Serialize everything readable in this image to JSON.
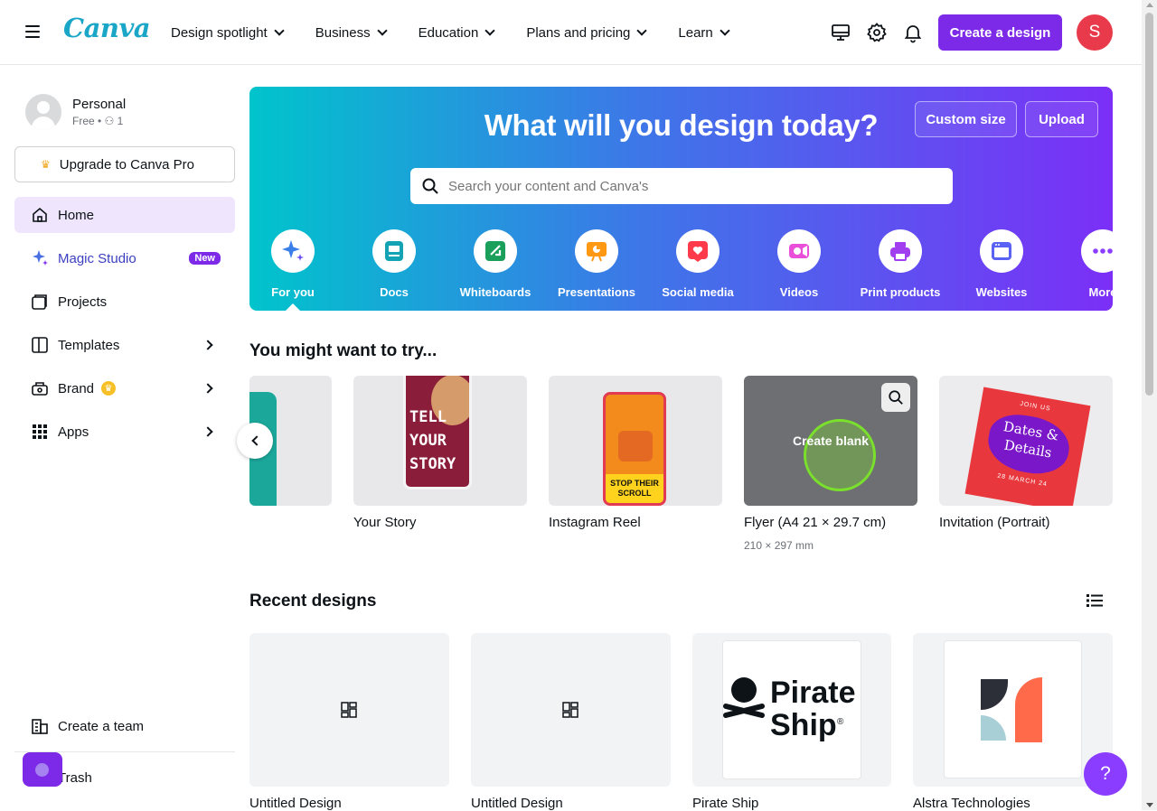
{
  "header": {
    "logo": "Canva",
    "nav": [
      {
        "label": "Design spotlight"
      },
      {
        "label": "Business"
      },
      {
        "label": "Education"
      },
      {
        "label": "Plans and pricing"
      },
      {
        "label": "Learn"
      }
    ],
    "create_label": "Create a design",
    "avatar_letter": "S"
  },
  "sidebar": {
    "profile_name": "Personal",
    "profile_sub": "Free • ⚇ 1",
    "upgrade_label": "Upgrade to Canva Pro",
    "items": [
      {
        "label": "Home"
      },
      {
        "label": "Magic Studio",
        "badge": "New"
      },
      {
        "label": "Projects"
      },
      {
        "label": "Templates"
      },
      {
        "label": "Brand"
      },
      {
        "label": "Apps"
      }
    ],
    "create_team": "Create a team",
    "trash": "Trash"
  },
  "hero": {
    "title": "What will you design today?",
    "custom_size": "Custom size",
    "upload": "Upload",
    "search_placeholder": "Search your content and Canva's",
    "categories": [
      {
        "label": "For you",
        "icon": "sparkle-icon",
        "color": "#3a7ee8"
      },
      {
        "label": "Docs",
        "icon": "doc-icon",
        "color": "#13a3b5"
      },
      {
        "label": "Whiteboards",
        "icon": "whiteboard-icon",
        "color": "#1aa05b"
      },
      {
        "label": "Presentations",
        "icon": "presentation-icon",
        "color": "#ff9914"
      },
      {
        "label": "Social media",
        "icon": "heart-icon",
        "color": "#ff3b4b"
      },
      {
        "label": "Videos",
        "icon": "video-icon",
        "color": "#e94fd8"
      },
      {
        "label": "Print products",
        "icon": "printer-icon",
        "color": "#a13ef0"
      },
      {
        "label": "Websites",
        "icon": "website-icon",
        "color": "#5a62f5"
      },
      {
        "label": "More",
        "icon": "more-icon",
        "color": "#8b3dff"
      }
    ]
  },
  "try": {
    "title": "You might want to try...",
    "cards": [
      {
        "label": "Your Story",
        "sub": "",
        "poster_text": "TELL YOUR STORY"
      },
      {
        "label": "Instagram Reel",
        "sub": "",
        "poster_text": "STOP THEIR SCROLL"
      },
      {
        "label": "Flyer (A4 21 × 29.7 cm)",
        "sub": "210 × 297 mm",
        "overlay": "Create blank"
      },
      {
        "label": "Invitation (Portrait)",
        "sub": "",
        "poster_top": "JOIN US",
        "poster_title": "Dates & Details",
        "poster_bottom": "28 MARCH 24"
      }
    ]
  },
  "recent": {
    "title": "Recent designs",
    "cards": [
      {
        "label": "Untitled Design"
      },
      {
        "label": "Untitled Design"
      },
      {
        "label": "Pirate Ship",
        "logo_text_1": "Pirate",
        "logo_text_2": "Ship",
        "mark": "®"
      },
      {
        "label": "Alstra Technologies"
      }
    ]
  },
  "help": "?",
  "colors": {
    "brand": "#7d2ae8",
    "accent": "#8b3dff"
  }
}
